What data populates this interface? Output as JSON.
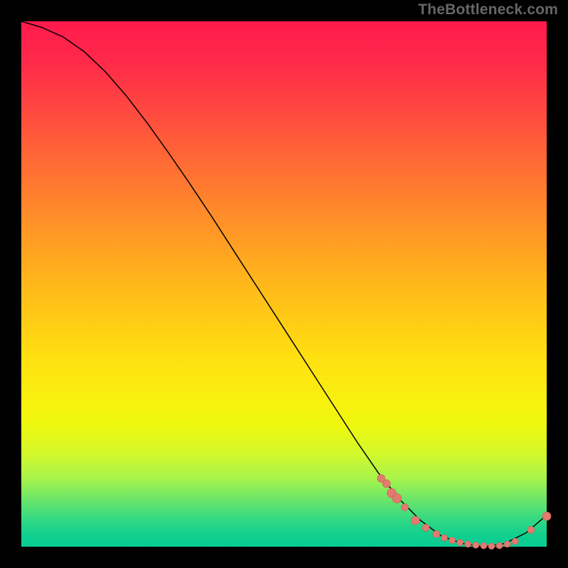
{
  "watermark": "TheBottleneck.com",
  "colors": {
    "background": "#000000",
    "gradient_top": "#ff1a4d",
    "gradient_bottom": "#07cc94",
    "curve": "#000000",
    "point_fill": "#e37a6f",
    "point_stroke": "#c95e54"
  },
  "chart_data": {
    "type": "line",
    "title": "",
    "xlabel": "",
    "ylabel": "",
    "xlim": [
      0,
      100
    ],
    "ylim": [
      0,
      100
    ],
    "curve": {
      "x": [
        0,
        4,
        8,
        12,
        16,
        20,
        24,
        28,
        32,
        36,
        40,
        44,
        48,
        52,
        56,
        60,
        64,
        68,
        72,
        76,
        80,
        84,
        88,
        92,
        96,
        100
      ],
      "y": [
        100,
        98.8,
        97.0,
        94.2,
        90.4,
        85.8,
        80.6,
        75.0,
        69.2,
        63.2,
        57.0,
        50.8,
        44.6,
        38.4,
        32.2,
        26.0,
        19.8,
        14.0,
        9.0,
        5.0,
        2.0,
        0.6,
        0.0,
        0.6,
        2.6,
        6.0
      ]
    },
    "series": [
      {
        "name": "points",
        "x": [
          68.5,
          69.5,
          70.5,
          71.5,
          73.0,
          75.0,
          77.0,
          79.0,
          80.5,
          82.0,
          83.5,
          85.0,
          86.5,
          88.0,
          89.5,
          91.0,
          92.5,
          94.0,
          97.0,
          100.0
        ],
        "y": [
          13.0,
          12.0,
          10.2,
          9.2,
          7.5,
          5.0,
          3.6,
          2.4,
          1.7,
          1.2,
          0.8,
          0.5,
          0.3,
          0.2,
          0.1,
          0.2,
          0.5,
          1.0,
          3.2,
          5.8
        ],
        "r": [
          5.5,
          5.5,
          6.5,
          6.5,
          5.0,
          6.0,
          5.0,
          5.0,
          4.5,
          4.5,
          4.5,
          4.5,
          4.5,
          4.5,
          4.5,
          4.5,
          4.5,
          4.5,
          5.0,
          6.0
        ]
      }
    ]
  }
}
